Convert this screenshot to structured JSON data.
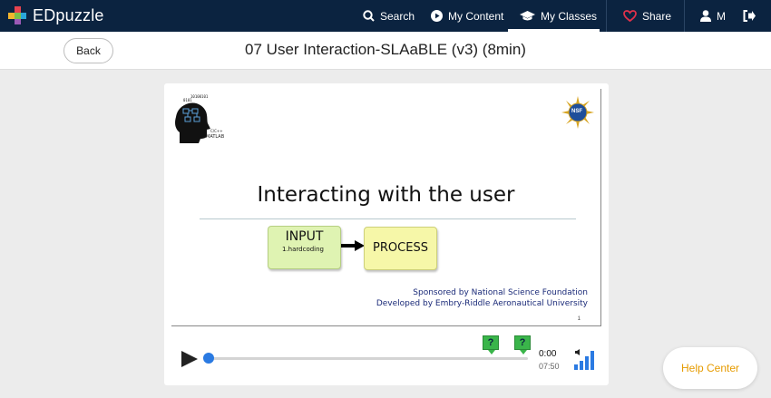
{
  "brand": {
    "name": "EDpuzzle"
  },
  "nav": {
    "search": "Search",
    "my_content": "My Content",
    "my_classes": "My Classes",
    "share": "Share",
    "user_initial": "M"
  },
  "subheader": {
    "back_label": "Back",
    "video_title": "07 User Interaction-SLAaBLE (v3) (8min)"
  },
  "slide": {
    "title": "Interacting with the user",
    "input_label": "INPUT",
    "input_sub": "1.hardcoding",
    "process_label": "PROCESS",
    "sponsor_line1": "Sponsored by National Science Foundation",
    "sponsor_line2": "Developed by Embry-Riddle Aeronautical University",
    "slide_number": "1",
    "logo_text": "MATLAB",
    "seal_text": "NSF"
  },
  "player": {
    "current_time": "0:00",
    "total_time": "07:50",
    "progress": 0.0,
    "question_markers": [
      {
        "label": "?"
      },
      {
        "label": "?"
      }
    ]
  },
  "help": {
    "label": "Help Center"
  },
  "colors": {
    "nav_bg": "#0b2340",
    "accent_blue": "#2a7ae2",
    "marker_green": "#3ab54a",
    "help_orange": "#e69b00",
    "share_red": "#e0314b"
  }
}
